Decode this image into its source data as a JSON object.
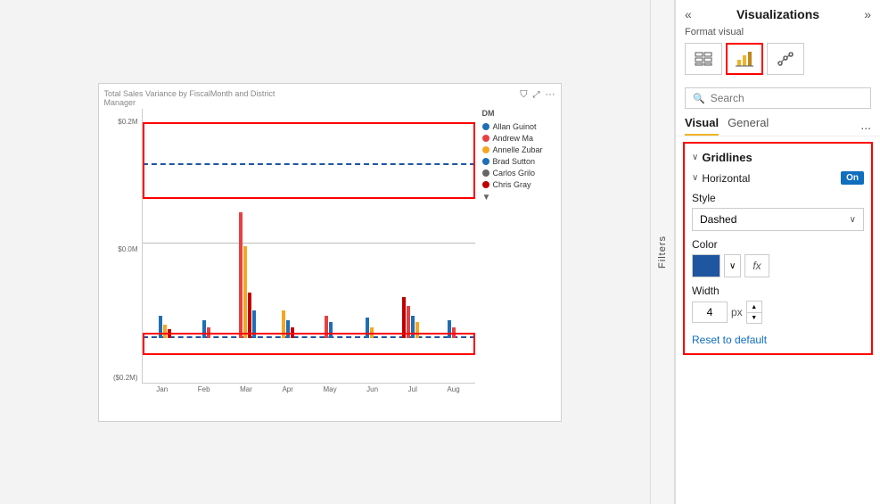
{
  "panel": {
    "title": "Visualizations",
    "collapse_icon": "«",
    "expand_icon": "»",
    "format_visual_label": "Format visual",
    "search_placeholder": "Search",
    "tabs": [
      {
        "id": "visual",
        "label": "Visual",
        "active": true
      },
      {
        "id": "general",
        "label": "General",
        "active": false
      }
    ],
    "tabs_more": "..."
  },
  "gridlines": {
    "section_title": "Gridlines",
    "horizontal": {
      "title": "Horizontal",
      "toggle": "On",
      "style_label": "Style",
      "style_value": "Dashed",
      "color_label": "Color",
      "width_label": "Width",
      "width_value": "4",
      "width_unit": "px",
      "reset_label": "Reset to default"
    }
  },
  "chart": {
    "title": "Total Sales Variance by FiscalMonth and District Manager",
    "y_labels": [
      "$0.2M",
      "$0.0M",
      "($0.2M)"
    ],
    "x_labels": [
      "Jan",
      "Feb",
      "Mar",
      "Apr",
      "May",
      "Jun",
      "Jul",
      "Aug"
    ],
    "legend_title": "DM",
    "legend_items": [
      {
        "name": "Allan Guinot",
        "color": "#1f6eb5"
      },
      {
        "name": "Andrew Ma",
        "color": "#e84040"
      },
      {
        "name": "Annelle Zubar",
        "color": "#f5a623"
      },
      {
        "name": "Brad Sutton",
        "color": "#1f6eb5"
      },
      {
        "name": "Carlos Grilo",
        "color": "#666666"
      },
      {
        "name": "Chris Gray",
        "color": "#c00000"
      }
    ]
  },
  "filters": {
    "label": "Filters"
  }
}
